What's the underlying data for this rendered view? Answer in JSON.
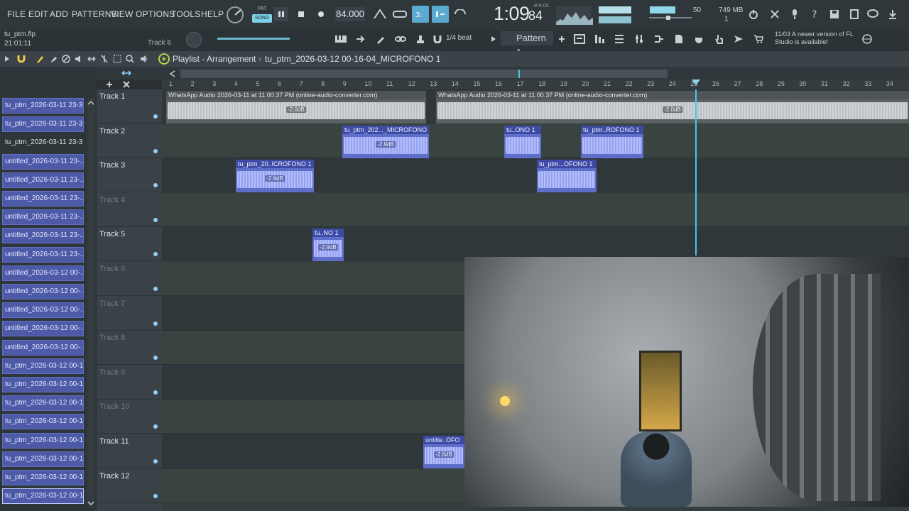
{
  "menu": {
    "items": [
      "FILE",
      "EDIT",
      "ADD",
      "PATTERNS",
      "VIEW",
      "OPTIONS",
      "TOOLS",
      "HELP"
    ]
  },
  "transport": {
    "pat_label": "PAT",
    "song_label": "SONG",
    "tempo": "84.000",
    "clock_main": "1:09",
    "clock_sub": "84",
    "clock_label": "M:S:CS",
    "volume_label": "50",
    "memory_label": "749 MB",
    "cpu_label": "1"
  },
  "project": {
    "file_name": "tu_ptm.flp",
    "time": "21:01:11",
    "channel_label": "Track 6",
    "snap": "1/4 beat",
    "pattern": "Pattern 1",
    "update_note": "11/03 A newer version of FL Studio is available!"
  },
  "playlist": {
    "title": "Playlist - Arrangement",
    "arrow": "›",
    "pattern_name": "tu_ptm_2026-03-12 00-16-04_MICROFONO 1"
  },
  "browser": {
    "items": [
      {
        "label": "tu_ptm_2026-03-11 23-3...",
        "style": "clip"
      },
      {
        "label": "tu_ptm_2026-03-11 23-3...",
        "style": "clip"
      },
      {
        "label": "tu_ptm_2026-03-11 23-3...",
        "style": "plain"
      },
      {
        "label": "untitled_2026-03-11 23-...",
        "style": "clip"
      },
      {
        "label": "untitled_2026-03-11 23-...",
        "style": "clip"
      },
      {
        "label": "untitled_2026-03-11 23-...",
        "style": "clip"
      },
      {
        "label": "untitled_2026-03-11 23-...",
        "style": "clip"
      },
      {
        "label": "untitled_2026-03-11 23-...",
        "style": "clip"
      },
      {
        "label": "untitled_2026-03-11 23-...",
        "style": "clip"
      },
      {
        "label": "untitled_2026-03-12 00-...",
        "style": "clip"
      },
      {
        "label": "untitled_2026-03-12 00-...",
        "style": "clip"
      },
      {
        "label": "untitled_2026-03-12 00-...",
        "style": "clip"
      },
      {
        "label": "untitled_2026-03-12 00-...",
        "style": "clip"
      },
      {
        "label": "untitled_2026-03-12 00-...",
        "style": "clip"
      },
      {
        "label": "tu_ptm_2026-03-12 00-1...",
        "style": "clip"
      },
      {
        "label": "tu_ptm_2026-03-12 00-1...",
        "style": "clip"
      },
      {
        "label": "tu_ptm_2026-03-12 00-1...",
        "style": "clip"
      },
      {
        "label": "tu_ptm_2026-03-12 00-1...",
        "style": "clip"
      },
      {
        "label": "tu_ptm_2026-03-12 00-1...",
        "style": "clip"
      },
      {
        "label": "tu_ptm_2026-03-12 00-1...",
        "style": "clip"
      },
      {
        "label": "tu_ptm_2026-03-12 00-1...",
        "style": "clip"
      },
      {
        "label": "tu_ptm_2026-03-12 00-1...",
        "style": "selected"
      }
    ]
  },
  "tracks": [
    {
      "name": "Track 1",
      "empty": false
    },
    {
      "name": "Track 2",
      "empty": false
    },
    {
      "name": "Track 3",
      "empty": false
    },
    {
      "name": "Track 4",
      "empty": true
    },
    {
      "name": "Track 5",
      "empty": false
    },
    {
      "name": "Track 6",
      "empty": true
    },
    {
      "name": "Track 7",
      "empty": true
    },
    {
      "name": "Track 8",
      "empty": true
    },
    {
      "name": "Track 9",
      "empty": true
    },
    {
      "name": "Track 10",
      "empty": true
    },
    {
      "name": "Track 11",
      "empty": false
    },
    {
      "name": "Track 12",
      "empty": false
    }
  ],
  "ruler": {
    "bars": [
      "1",
      "2",
      "3",
      "4",
      "5",
      "6",
      "7",
      "8",
      "9",
      "10",
      "11",
      "12",
      "13",
      "14",
      "15",
      "16",
      "17",
      "18",
      "19",
      "20",
      "21",
      "22",
      "23",
      "24",
      "25",
      "26",
      "27",
      "28",
      "29",
      "30",
      "31",
      "32",
      "33",
      "34"
    ]
  },
  "clips": [
    {
      "title": "WhatsApp Audio 2026-03-11 at 11.00.37 PM (online-audio-converter.com)",
      "gain": "-2.0dB",
      "color": "gray"
    },
    {
      "title": "WhatsApp Audio 2026-03-11 at 11.00.37 PM (online-audio-converter.com)",
      "gain": "-2.0dB",
      "color": "gray"
    },
    {
      "title": "tu_ptm_202..._MICROFONO 1",
      "gain": "-2.9dB",
      "color": "blue"
    },
    {
      "title": "tu..ONO 1",
      "gain": "",
      "color": "blue"
    },
    {
      "title": "tu_ptm..ROFONO 1",
      "gain": "",
      "color": "blue"
    },
    {
      "title": "tu_ptm_20..ICROFONO 1",
      "gain": "-2.9dB",
      "color": "blue"
    },
    {
      "title": "tu_ptm...OFONO 1",
      "gain": "",
      "color": "blue"
    },
    {
      "title": "tu..NO 1",
      "gain": "-2.9dB",
      "color": "blue"
    },
    {
      "title": "untitle..OFO",
      "gain": "-2.6dB",
      "color": "blue"
    }
  ],
  "icons": {
    "snap": "magnet-icon",
    "play": "play-icon",
    "stop": "stop-icon",
    "record": "record-icon",
    "pause": "pause-icon"
  }
}
